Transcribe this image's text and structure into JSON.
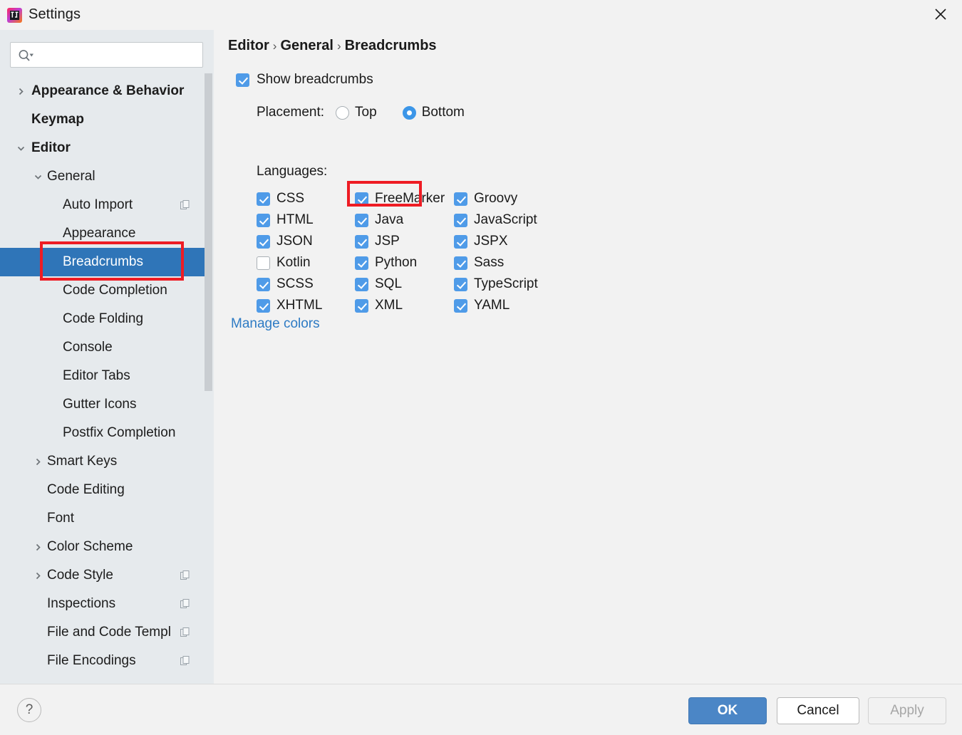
{
  "window": {
    "title": "Settings",
    "logo_icon": "intellij-idea-logo",
    "close_icon": "close-icon"
  },
  "sidebar": {
    "search": {
      "value": "",
      "placeholder": "",
      "icon": "search-icon",
      "dropdown_icon": "chevron-down-icon"
    },
    "items": [
      {
        "label": "Appearance & Behavior",
        "indent": 1,
        "arrow": "chevron-right-icon",
        "bold": true,
        "selected": false,
        "badge": false
      },
      {
        "label": "Keymap",
        "indent": 1,
        "arrow": "",
        "bold": true,
        "selected": false,
        "badge": false
      },
      {
        "label": "Editor",
        "indent": 1,
        "arrow": "chevron-down-icon",
        "bold": true,
        "selected": false,
        "badge": false
      },
      {
        "label": "General",
        "indent": 2,
        "arrow": "chevron-down-icon",
        "bold": false,
        "selected": false,
        "badge": false
      },
      {
        "label": "Auto Import",
        "indent": 3,
        "arrow": "",
        "bold": false,
        "selected": false,
        "badge": true
      },
      {
        "label": "Appearance",
        "indent": 3,
        "arrow": "",
        "bold": false,
        "selected": false,
        "badge": false
      },
      {
        "label": "Breadcrumbs",
        "indent": 3,
        "arrow": "",
        "bold": false,
        "selected": true,
        "badge": false
      },
      {
        "label": "Code Completion",
        "indent": 3,
        "arrow": "",
        "bold": false,
        "selected": false,
        "badge": false
      },
      {
        "label": "Code Folding",
        "indent": 3,
        "arrow": "",
        "bold": false,
        "selected": false,
        "badge": false
      },
      {
        "label": "Console",
        "indent": 3,
        "arrow": "",
        "bold": false,
        "selected": false,
        "badge": false
      },
      {
        "label": "Editor Tabs",
        "indent": 3,
        "arrow": "",
        "bold": false,
        "selected": false,
        "badge": false
      },
      {
        "label": "Gutter Icons",
        "indent": 3,
        "arrow": "",
        "bold": false,
        "selected": false,
        "badge": false
      },
      {
        "label": "Postfix Completion",
        "indent": 3,
        "arrow": "",
        "bold": false,
        "selected": false,
        "badge": false
      },
      {
        "label": "Smart Keys",
        "indent": 2,
        "arrow": "chevron-right-icon",
        "bold": false,
        "selected": false,
        "badge": false
      },
      {
        "label": "Code Editing",
        "indent": 2,
        "arrow": "",
        "bold": false,
        "selected": false,
        "badge": false
      },
      {
        "label": "Font",
        "indent": 2,
        "arrow": "",
        "bold": false,
        "selected": false,
        "badge": false
      },
      {
        "label": "Color Scheme",
        "indent": 2,
        "arrow": "chevron-right-icon",
        "bold": false,
        "selected": false,
        "badge": false
      },
      {
        "label": "Code Style",
        "indent": 2,
        "arrow": "chevron-right-icon",
        "bold": false,
        "selected": false,
        "badge": true
      },
      {
        "label": "Inspections",
        "indent": 2,
        "arrow": "",
        "bold": false,
        "selected": false,
        "badge": true
      },
      {
        "label": "File and Code Templ",
        "indent": 2,
        "arrow": "",
        "bold": false,
        "selected": false,
        "badge": true
      },
      {
        "label": "File Encodings",
        "indent": 2,
        "arrow": "",
        "bold": false,
        "selected": false,
        "badge": true
      }
    ],
    "scrollbar": {
      "name": "sidebar-scrollbar"
    }
  },
  "main": {
    "breadcrumb": {
      "parts": [
        "Editor",
        "General",
        "Breadcrumbs"
      ],
      "separator": "›"
    },
    "show_breadcrumbs": {
      "label": "Show breadcrumbs",
      "checked": true
    },
    "placement": {
      "label": "Placement:",
      "options": [
        {
          "label": "Top",
          "selected": false
        },
        {
          "label": "Bottom",
          "selected": true
        }
      ]
    },
    "languages_label": "Languages:",
    "languages": {
      "columns": [
        [
          {
            "label": "CSS",
            "checked": true
          },
          {
            "label": "HTML",
            "checked": true
          },
          {
            "label": "JSON",
            "checked": true
          },
          {
            "label": "Kotlin",
            "checked": false
          },
          {
            "label": "SCSS",
            "checked": true
          },
          {
            "label": "XHTML",
            "checked": true
          }
        ],
        [
          {
            "label": "FreeMarker",
            "checked": true
          },
          {
            "label": "Java",
            "checked": true
          },
          {
            "label": "JSP",
            "checked": true
          },
          {
            "label": "Python",
            "checked": true
          },
          {
            "label": "SQL",
            "checked": true
          },
          {
            "label": "XML",
            "checked": true
          }
        ],
        [
          {
            "label": "Groovy",
            "checked": true
          },
          {
            "label": "JavaScript",
            "checked": true
          },
          {
            "label": "JSPX",
            "checked": true
          },
          {
            "label": "Sass",
            "checked": true
          },
          {
            "label": "TypeScript",
            "checked": true
          },
          {
            "label": "YAML",
            "checked": true
          }
        ]
      ]
    },
    "manage_colors_link": "Manage colors"
  },
  "footer": {
    "help_label": "?",
    "ok_label": "OK",
    "cancel_label": "Cancel",
    "apply_label": "Apply"
  },
  "annotations": {
    "highlight_color": "#ee1c24",
    "boxes": [
      {
        "name": "highlight-breadcrumbs-sidebar",
        "target": "Breadcrumbs"
      },
      {
        "name": "highlight-java-checkbox",
        "target": "Java"
      }
    ]
  },
  "colors": {
    "selection_blue": "#2f75b8",
    "checkbox_blue": "#4f9be8",
    "link_blue": "#2e7bc4",
    "sidebar_bg": "#e6eaed",
    "panel_bg": "#f2f2f2",
    "ok_button": "#4b86c6"
  }
}
